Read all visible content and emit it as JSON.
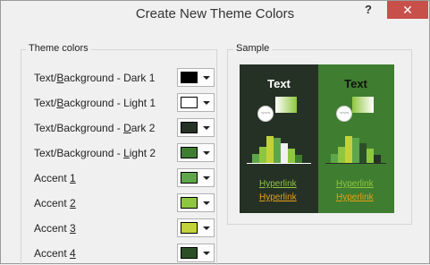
{
  "dialog": {
    "title": "Create New Theme Colors",
    "help_label": "?",
    "close_label": "✕"
  },
  "theme_colors": {
    "legend": "Theme colors",
    "rows": [
      {
        "prefix": "Text/",
        "accel": "B",
        "suffix": "ackground - Dark 1",
        "color": "#000000"
      },
      {
        "prefix": "Text/",
        "accel": "B",
        "suffix": "ackground - Light 1",
        "color": "#ffffff"
      },
      {
        "prefix": "Text/Background - ",
        "accel": "D",
        "suffix": "ark 2",
        "color": "#263126"
      },
      {
        "prefix": "Text/Background - ",
        "accel": "L",
        "suffix": "ight 2",
        "color": "#3f7d30"
      },
      {
        "prefix": "Accent ",
        "accel": "1",
        "suffix": "",
        "color": "#5ea64a"
      },
      {
        "prefix": "Accent ",
        "accel": "2",
        "suffix": "",
        "color": "#8ec63f"
      },
      {
        "prefix": "Accent ",
        "accel": "3",
        "suffix": "",
        "color": "#c3d23a"
      },
      {
        "prefix": "Accent ",
        "accel": "4",
        "suffix": "",
        "color": "#2b4f26"
      }
    ]
  },
  "sample": {
    "legend": "Sample",
    "heading": "Text",
    "circle_text": "~~~",
    "hyperlink": "Hyperlink",
    "followed_hyperlink": "Hyperlink",
    "colors": {
      "dark_bg": "#263126",
      "light_bg": "#3f7d30",
      "hyperlink": "#8ec63f",
      "followed": "#e4a018"
    }
  }
}
